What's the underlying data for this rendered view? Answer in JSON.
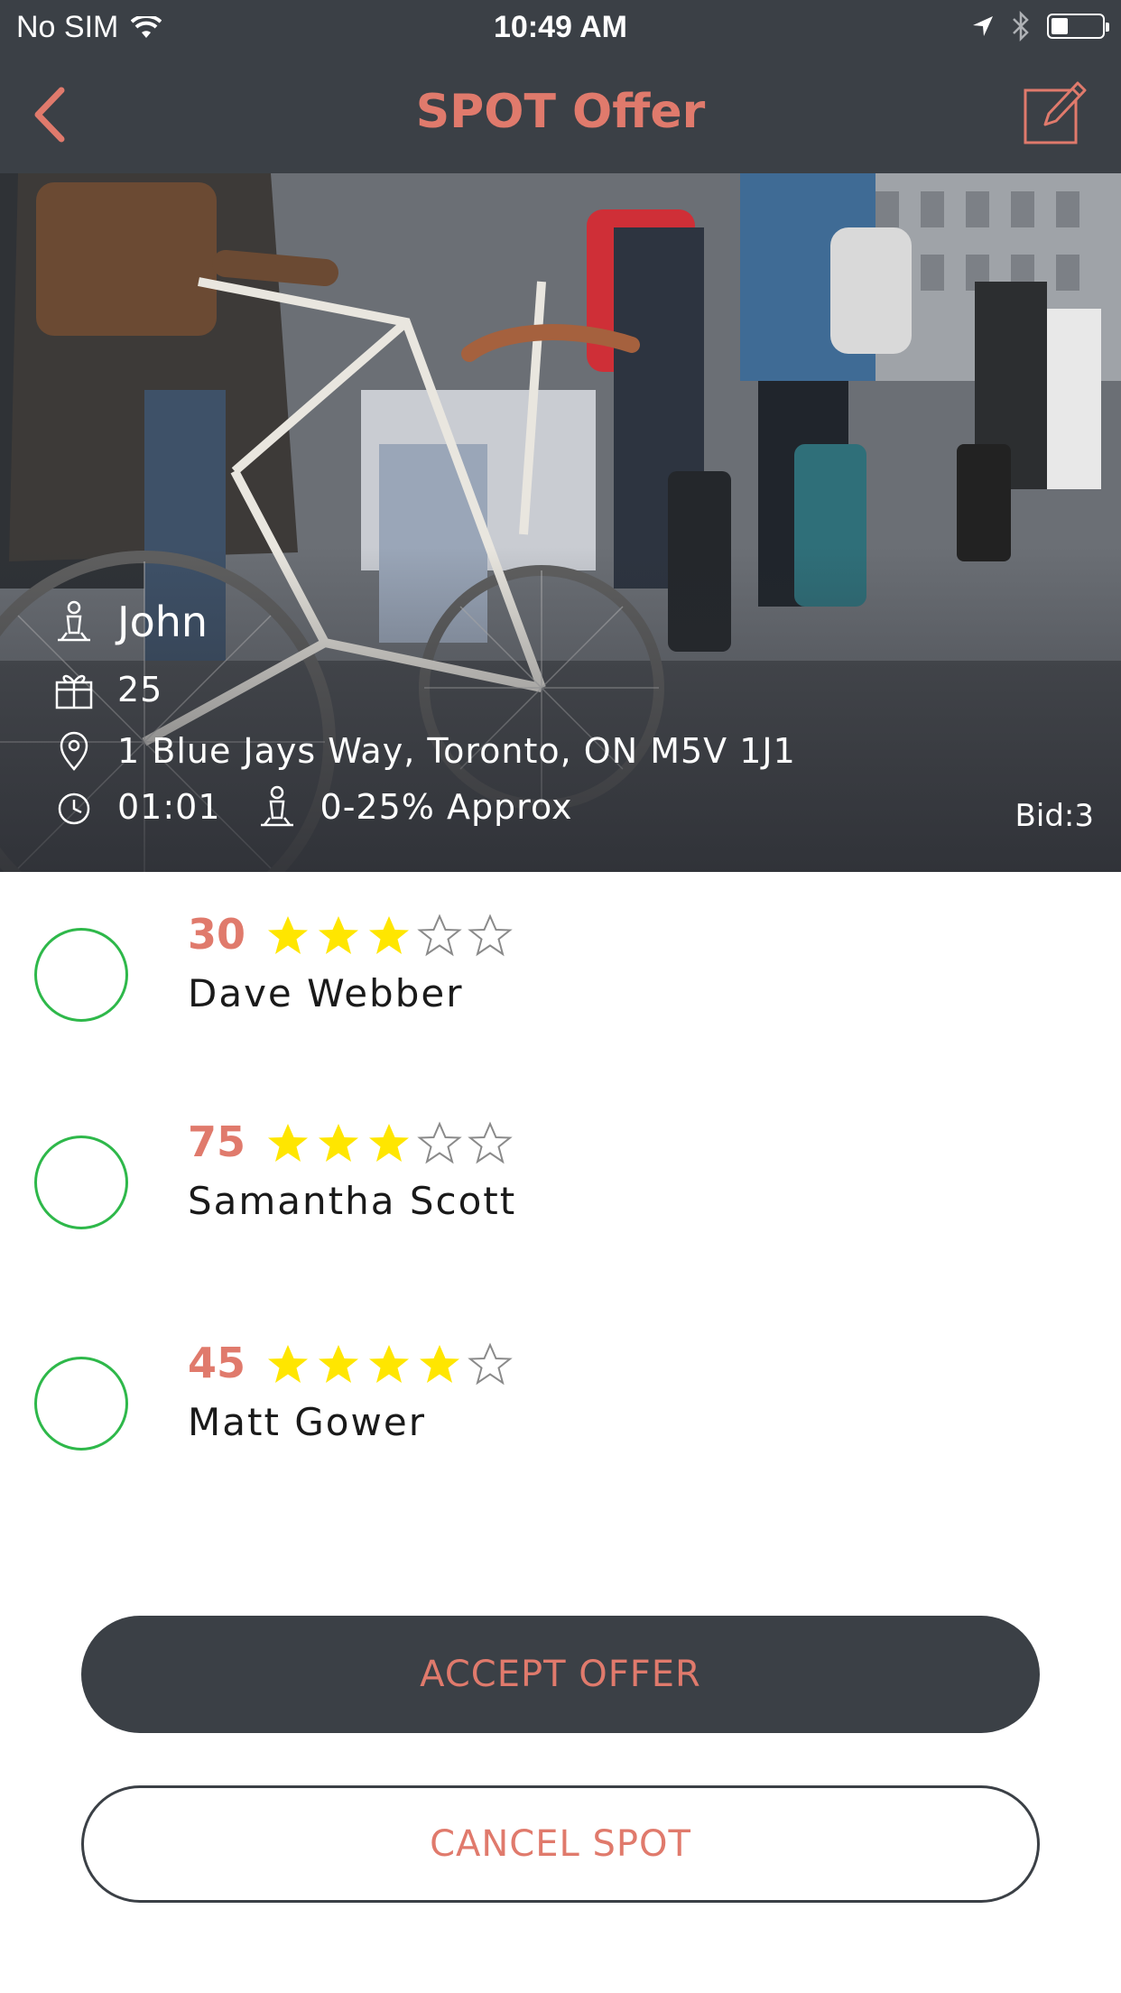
{
  "status_bar": {
    "carrier": "No SIM",
    "time": "10:49 AM",
    "battery_level": 0.35
  },
  "nav": {
    "title": "SPOT Offer",
    "back_icon": "chevron-left-icon",
    "edit_icon": "edit-icon"
  },
  "spot": {
    "name": "John",
    "quantity": "25",
    "address": "1 Blue Jays Way, Toronto, ON M5V 1J1",
    "time": "01:01",
    "discount": "0-25% Approx",
    "bid": "Bid:3"
  },
  "offers": [
    {
      "amount": "30",
      "rating": 3,
      "max_rating": 5,
      "name": "Dave Webber"
    },
    {
      "amount": "75",
      "rating": 3,
      "max_rating": 5,
      "name": "Samantha Scott"
    },
    {
      "amount": "45",
      "rating": 4,
      "max_rating": 5,
      "name": "Matt Gower"
    }
  ],
  "buttons": {
    "accept_label": "ACCEPT OFFER",
    "cancel_label": "CANCEL SPOT"
  },
  "colors": {
    "accent": "#e07a6c",
    "bar_bg": "#3b4046",
    "radio_border": "#2eb84a",
    "star_filled": "#ffe600",
    "star_empty": "#8a8a8a"
  }
}
